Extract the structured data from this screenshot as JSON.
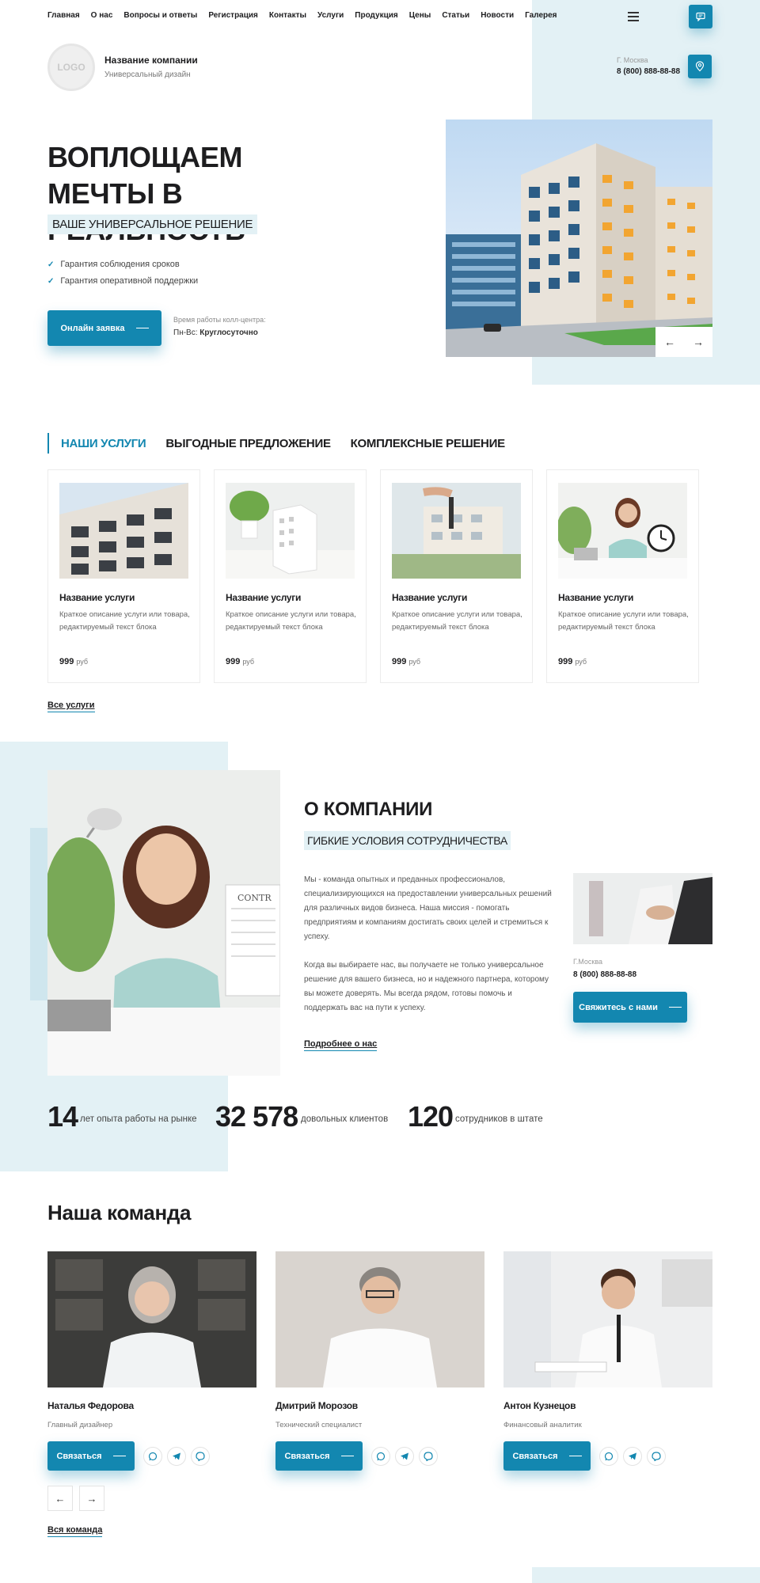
{
  "nav": {
    "items": [
      "Главная",
      "О нас",
      "Вопросы и ответы",
      "Регистрация",
      "Контакты",
      "Услуги",
      "Продукция",
      "Цены",
      "Статьи",
      "Новости",
      "Галерея"
    ]
  },
  "header": {
    "logo_text": "LOGO",
    "company_name": "Название компании",
    "company_subtitle": "Универсальный дизайн",
    "city": "Г. Москва",
    "phone": "8 (800) 888-88-88"
  },
  "hero": {
    "title": "ВОПЛОЩАЕМ МЕЧТЫ В РЕАЛЬНОСТЬ",
    "subtitle": "ВАШЕ УНИВЕРСАЛЬНОЕ РЕШЕНИЕ",
    "checks": [
      "Гарантия соблюдения сроков",
      "Гарантия оперативной поддержки"
    ],
    "cta_label": "Онлайн заявка",
    "hours_label": "Время работы колл-центра:",
    "hours_days": "Пн-Вс:",
    "hours_value": "Круглосуточно",
    "prev_arrow": "←",
    "next_arrow": "→"
  },
  "services": {
    "tabs": [
      "НАШИ УСЛУГИ",
      "ВЫГОДНЫЕ ПРЕДЛОЖЕНИЕ",
      "КОМПЛЕКСНЫЕ РЕШЕНИЕ"
    ],
    "cards": [
      {
        "title": "Название услуги",
        "desc": "Краткое описание услуги или товара, редактируемый текст блока",
        "price": "999",
        "currency": "руб"
      },
      {
        "title": "Название услуги",
        "desc": "Краткое описание услуги или товара, редактируемый текст блока",
        "price": "999",
        "currency": "руб"
      },
      {
        "title": "Название услуги",
        "desc": "Краткое описание услуги или товара, редактируемый текст блока",
        "price": "999",
        "currency": "руб"
      },
      {
        "title": "Название услуги",
        "desc": "Краткое описание услуги или товара, редактируемый текст блока",
        "price": "999",
        "currency": "руб"
      }
    ],
    "all_link": "Все услуги"
  },
  "about": {
    "title": "О КОМПАНИИ",
    "subtitle": "ГИБКИЕ УСЛОВИЯ СОТРУДНИЧЕСТВА",
    "para1": "Мы - команда опытных и преданных профессионалов, специализирующихся на предоставлении универсальных решений для различных видов бизнеса. Наша миссия - помогать предприятиям и компаниям достигать своих целей и стремиться к успеху.",
    "para2": "Когда вы выбираете нас, вы получаете не только универсальное решение для вашего бизнеса, но и надежного партнера, которому вы можете доверять. Мы всегда рядом, готовы помочь и поддержать вас на пути к успеху.",
    "more_link": "Подробнее о нас",
    "city": "Г.Москва",
    "phone": "8 (800) 888-88-88",
    "contact_button": "Свяжитесь с нами"
  },
  "stats": [
    {
      "value": "14",
      "label": "лет опыта работы на рынке"
    },
    {
      "value": "32 578",
      "label": "довольных клиентов"
    },
    {
      "value": "120",
      "label": "сотрудников в штате"
    }
  ],
  "team": {
    "title": "Наша команда",
    "members": [
      {
        "name": "Наталья Федорова",
        "role": "Главный дизайнер",
        "button": "Связаться"
      },
      {
        "name": "Дмитрий Морозов",
        "role": "Технический специалист",
        "button": "Связаться"
      },
      {
        "name": "Антон Кузнецов",
        "role": "Финансовый аналитик",
        "button": "Связаться"
      }
    ],
    "prev_arrow": "←",
    "next_arrow": "→",
    "all_link": "Вся команда"
  },
  "colors": {
    "accent": "#1387b0",
    "panel": "#e3f1f5",
    "text": "#1d1d1f"
  },
  "icons": [
    "menu-icon",
    "chat-icon",
    "location-icon",
    "check-icon",
    "whatsapp-icon",
    "telegram-icon",
    "viber-icon"
  ]
}
